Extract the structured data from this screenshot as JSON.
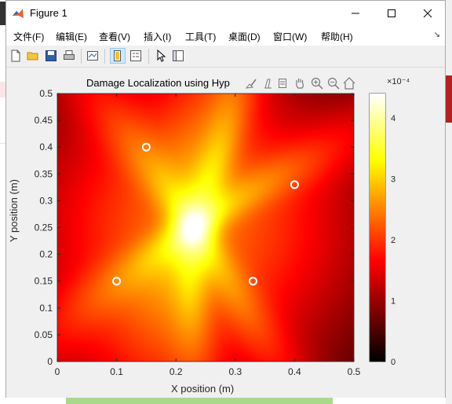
{
  "window": {
    "title": "Figure 1"
  },
  "menu": [
    {
      "label": "文件(F)"
    },
    {
      "label": "编辑(E)"
    },
    {
      "label": "查看(V)"
    },
    {
      "label": "插入(I)"
    },
    {
      "label": "工具(T)"
    },
    {
      "label": "桌面(D)"
    },
    {
      "label": "窗口(W)"
    },
    {
      "label": "帮助(H)"
    }
  ],
  "toolbar_icons": [
    "new-figure-icon",
    "open-file-icon",
    "save-icon",
    "print-icon",
    "link-plot-icon",
    "colorbar-toggle-icon",
    "legend-toggle-icon",
    "pointer-icon",
    "property-inspector-icon"
  ],
  "axes_toolbar_icons": [
    "brush-icon",
    "data-tips-icon",
    "export-icon",
    "pan-icon",
    "zoom-in-icon",
    "zoom-out-icon",
    "home-icon"
  ],
  "chart_data": {
    "type": "heatmap",
    "title": "Damage Localization using Hyp",
    "xlabel": "X position (m)",
    "ylabel": "Y position (m)",
    "xlim": [
      0,
      0.5
    ],
    "ylim": [
      0,
      0.5
    ],
    "xticks": [
      "0",
      "0.1",
      "0.2",
      "0.3",
      "0.4",
      "0.5"
    ],
    "yticks": [
      "0",
      "0.05",
      "0.1",
      "0.15",
      "0.2",
      "0.25",
      "0.3",
      "0.35",
      "0.4",
      "0.45",
      "0.5"
    ],
    "colormap": "hot",
    "colorbar": {
      "exponent_label": "×10⁻⁴",
      "ticks": [
        "0",
        "1",
        "2",
        "3",
        "4"
      ],
      "range": [
        0,
        4.4
      ]
    },
    "sensors": [
      {
        "x": 0.15,
        "y": 0.4
      },
      {
        "x": 0.4,
        "y": 0.33
      },
      {
        "x": 0.1,
        "y": 0.15
      },
      {
        "x": 0.33,
        "y": 0.15
      }
    ],
    "peak": {
      "x": 0.23,
      "y": 0.25
    }
  },
  "colors": {
    "window_bg": "#f0f0f0",
    "titlebar_bg": "#ffffff",
    "sensor_marker": "#ffffff"
  }
}
